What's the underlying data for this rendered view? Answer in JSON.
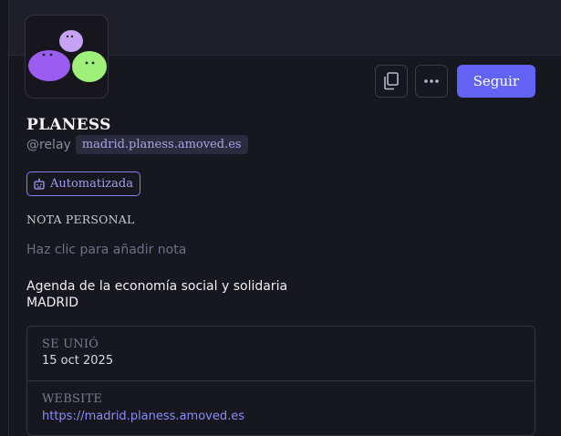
{
  "profile": {
    "display_name": "PLANESS",
    "handle": "@relay",
    "domain": "madrid.planess.amoved.es",
    "bot_badge": "Automatizada",
    "bio_line1": "Agenda de la economía social y solidaria",
    "bio_line2": "MADRID"
  },
  "actions": {
    "copy_icon": "copy-icon",
    "more_icon": "more-horizontal-icon",
    "follow_label": "Seguir",
    "accent_color": "#6262f5"
  },
  "note": {
    "label": "NOTA PERSONAL",
    "placeholder": "Haz clic para añadir nota"
  },
  "fields": [
    {
      "label": "SE UNIÓ",
      "value": "15 oct 2025"
    },
    {
      "label": "WEBSITE",
      "value": "https://madrid.planess.amoved.es"
    }
  ]
}
